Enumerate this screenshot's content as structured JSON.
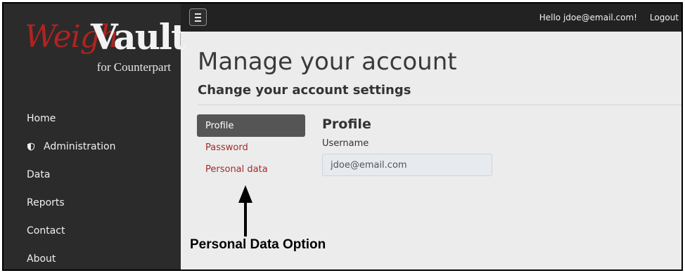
{
  "logo": {
    "brand_part1": "Weigh",
    "brand_part2": "Vault",
    "tagline": "for Counterpart"
  },
  "sidebar": {
    "items": [
      {
        "label": "Home",
        "icon": ""
      },
      {
        "label": "Administration",
        "icon": "shield-icon"
      },
      {
        "label": "Data",
        "icon": ""
      },
      {
        "label": "Reports",
        "icon": ""
      },
      {
        "label": "Contact",
        "icon": ""
      },
      {
        "label": "About",
        "icon": ""
      }
    ]
  },
  "topbar": {
    "menu_icon": "menu-icon",
    "greeting": "Hello jdoe@email.com!",
    "logout_label": "Logout"
  },
  "main": {
    "title": "Manage your account",
    "subtitle": "Change your account settings",
    "tabs": [
      {
        "label": "Profile",
        "active": true
      },
      {
        "label": "Password",
        "active": false
      },
      {
        "label": "Personal data",
        "active": false
      }
    ],
    "section_title": "Profile",
    "username": {
      "label": "Username",
      "value": "jdoe@email.com"
    }
  },
  "annotation": {
    "label": "Personal Data Option"
  },
  "colors": {
    "sidebar_bg": "#2b2b2b",
    "topbar_bg": "#222222",
    "content_bg": "#ececec",
    "link": "#a52a2a",
    "active_tab": "#555555",
    "brand_red": "#b0231f"
  }
}
